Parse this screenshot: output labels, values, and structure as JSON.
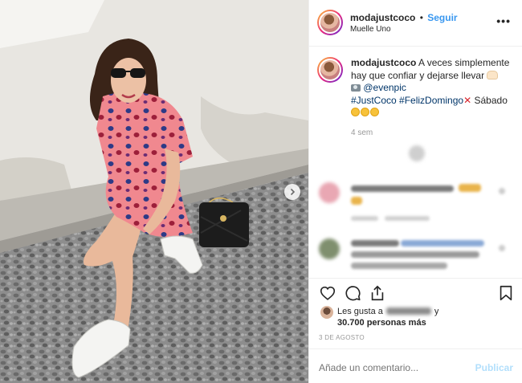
{
  "post": {
    "username": "modajustcoco",
    "separator": "•",
    "follow_label": "Seguir",
    "location": "Muelle Uno",
    "more_label": "•••"
  },
  "caption": {
    "username": "modajustcoco",
    "text_1": " A veces simplemente hay que confiar y dejarse llevar ",
    "mention": "@evenpic",
    "hashtag_1": "#JustCoco",
    "hashtag_2": "#FelizDomingo",
    "text_2": "Sábado",
    "time": "4 sem"
  },
  "likes": {
    "prefix": "Les gusta a",
    "conjunction": "y",
    "count_text": "30.700 personas más"
  },
  "date": "3 DE AGOSTO",
  "comment_box": {
    "placeholder": "Añade un comentario...",
    "publish_label": "Publicar"
  },
  "colors": {
    "link_blue": "#3897f0",
    "hashtag_blue": "#003569",
    "muted": "#999999",
    "publish_disabled": "#b2dffc"
  },
  "icons": [
    "heart-icon",
    "comment-icon",
    "share-icon",
    "bookmark-icon",
    "chevron-right-icon",
    "camera-icon",
    "cross-mark-icon",
    "laughing-emoji-icon",
    "praying-hands-icon"
  ]
}
